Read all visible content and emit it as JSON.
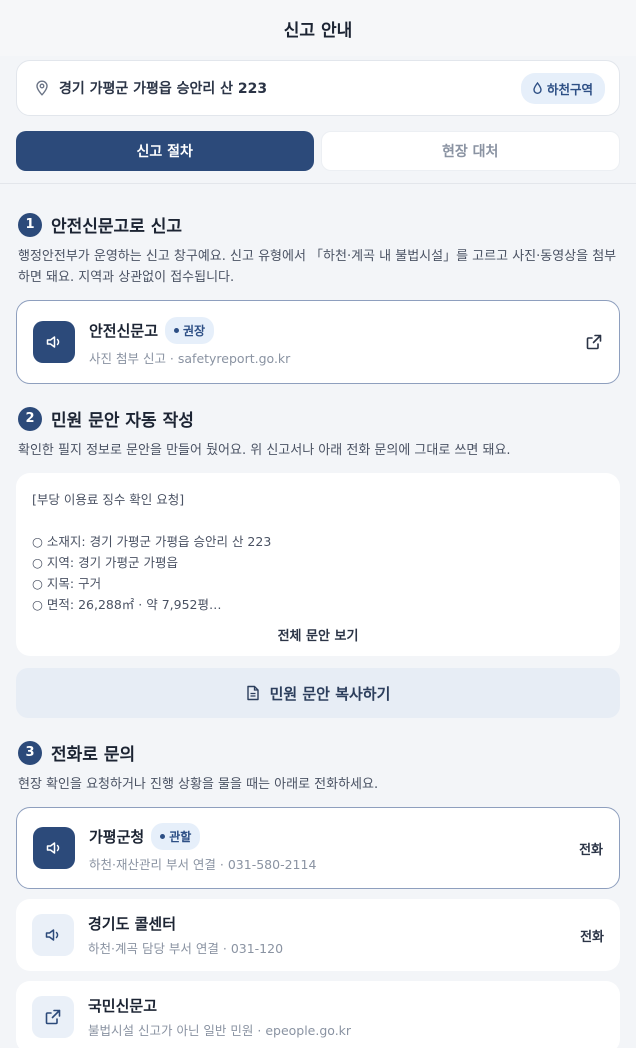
{
  "header": {
    "title": "신고 안내"
  },
  "location": {
    "address": "경기 가평군 가평읍 승안리 산 223",
    "zone_badge": "하천구역"
  },
  "tabs": [
    {
      "label": "신고 절차"
    },
    {
      "label": "현장 대처"
    }
  ],
  "sections": [
    {
      "number": "1",
      "title": "안전신문고로 신고",
      "description": "행정안전부가 운영하는 신고 창구예요. 신고 유형에서 「하천·계곡 내 불법시설」를 고르고 사진·동영상을 첨부하면 돼요. 지역과 상관없이 접수됩니다."
    },
    {
      "number": "2",
      "title": "민원 문안 자동 작성",
      "description": "확인한 필지 정보로 문안을 만들어 뒀어요. 위 신고서나 아래 전화 문의에 그대로 쓰면 돼요."
    },
    {
      "number": "3",
      "title": "전화로 문의",
      "description": "현장 확인을 요청하거나 진행 상황을 물을 때는 아래로 전화하세요."
    }
  ],
  "safety_card": {
    "title": "안전신문고",
    "badge": "권장",
    "subtitle": "사진 첨부 신고 · safetyreport.go.kr"
  },
  "draft": {
    "header": "[부당 이용료 징수 확인 요청]",
    "lines": [
      "○ 소재지: 경기 가평군 가평읍 승안리 산 223",
      "○ 지역: 경기 가평군 가평읍",
      "○ 지목: 구거",
      "○ 면적: 26,288㎡ · 약 7,952평…"
    ],
    "more": "전체 문안 보기"
  },
  "copy_button": {
    "label": "민원 문안 복사하기"
  },
  "contacts": [
    {
      "title": "가평군청",
      "badge": "관할",
      "subtitle": "하천·재산관리 부서 연결 · 031-580-2114",
      "action": "전화"
    },
    {
      "title": "경기도 콜센터",
      "subtitle": "하천·계곡 담당 부서 연결 · 031-120",
      "action": "전화"
    },
    {
      "title": "국민신문고",
      "subtitle": "불법시설 신고가 아닌 일반 민원 · epeople.go.kr"
    }
  ],
  "colors": {
    "primary": "#2c4a7a",
    "badge_bg": "#e6effa",
    "background": "#f3f5f8"
  },
  "icons": {
    "location": "map-pin-icon",
    "zone": "water-drop-icon",
    "speaker": "speaker-icon",
    "external": "external-link-icon",
    "document": "document-icon"
  }
}
